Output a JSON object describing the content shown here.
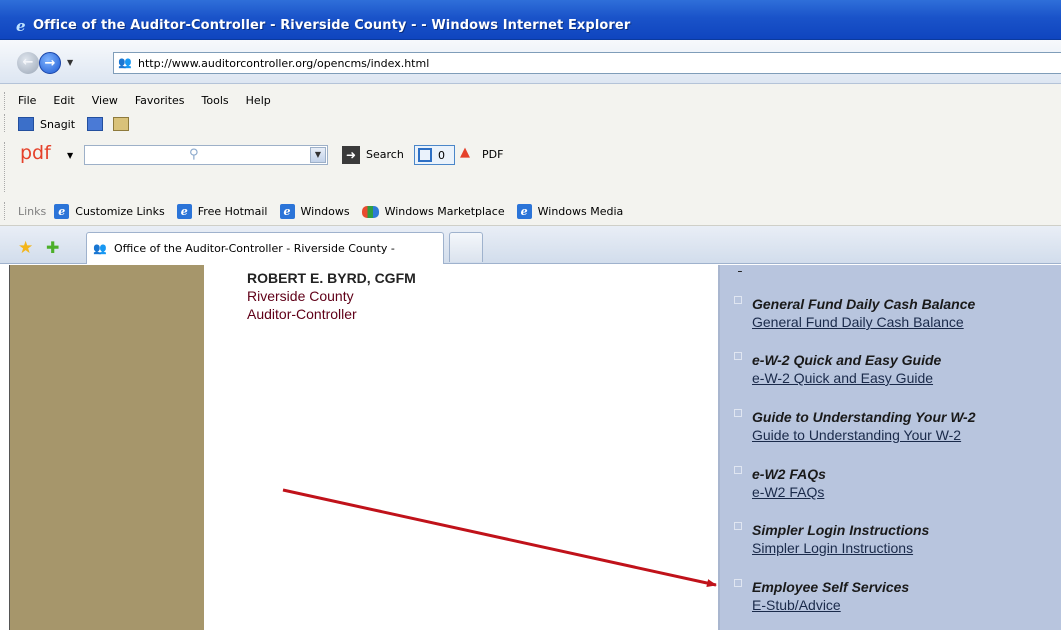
{
  "window": {
    "title": "Office of the Auditor-Controller - Riverside County - - Windows Internet Explorer"
  },
  "address": {
    "url": "http://www.auditorcontroller.org/opencms/index.html"
  },
  "menu": [
    "File",
    "Edit",
    "View",
    "Favorites",
    "Tools",
    "Help"
  ],
  "snagit": {
    "label": "Snagit"
  },
  "pdf_toolbar": {
    "logo": "pdf",
    "search_label": "Search",
    "count": "0",
    "pdf_label": "PDF"
  },
  "links_bar": {
    "title": "Links",
    "items": [
      {
        "label": "Customize Links",
        "icon": "ie-icon"
      },
      {
        "label": "Free Hotmail",
        "icon": "ie-icon"
      },
      {
        "label": "Windows",
        "icon": "ie-icon"
      },
      {
        "label": "Windows Marketplace",
        "icon": "windows-marketplace-icon"
      },
      {
        "label": "Windows Media",
        "icon": "ie-icon"
      }
    ]
  },
  "tab": {
    "label": "Office of the Auditor-Controller - Riverside County -"
  },
  "page": {
    "officer": {
      "name": "ROBERT E. BYRD, CGFM",
      "line1": "Riverside County",
      "line2": "Auditor-Controller"
    },
    "right_items": [
      {
        "heading": "General Fund Daily Cash Balance",
        "link": "General Fund Daily Cash Balance"
      },
      {
        "heading": "e-W-2 Quick and Easy Guide",
        "link": "e-W-2 Quick and Easy Guide"
      },
      {
        "heading": "Guide to Understanding Your W-2",
        "link": "Guide to Understanding Your W-2"
      },
      {
        "heading": "e-W2 FAQs",
        "link": "e-W2 FAQs"
      },
      {
        "heading": "Simpler Login Instructions",
        "link": "Simpler Login Instructions"
      },
      {
        "heading": "Employee Self Services",
        "link": "E-Stub/Advice"
      }
    ]
  },
  "colors": {
    "sidebar_left": "#a6966b",
    "sidebar_right": "#b8c5de",
    "officer_text": "#600018",
    "annotation_arrow": "#c0121a"
  }
}
